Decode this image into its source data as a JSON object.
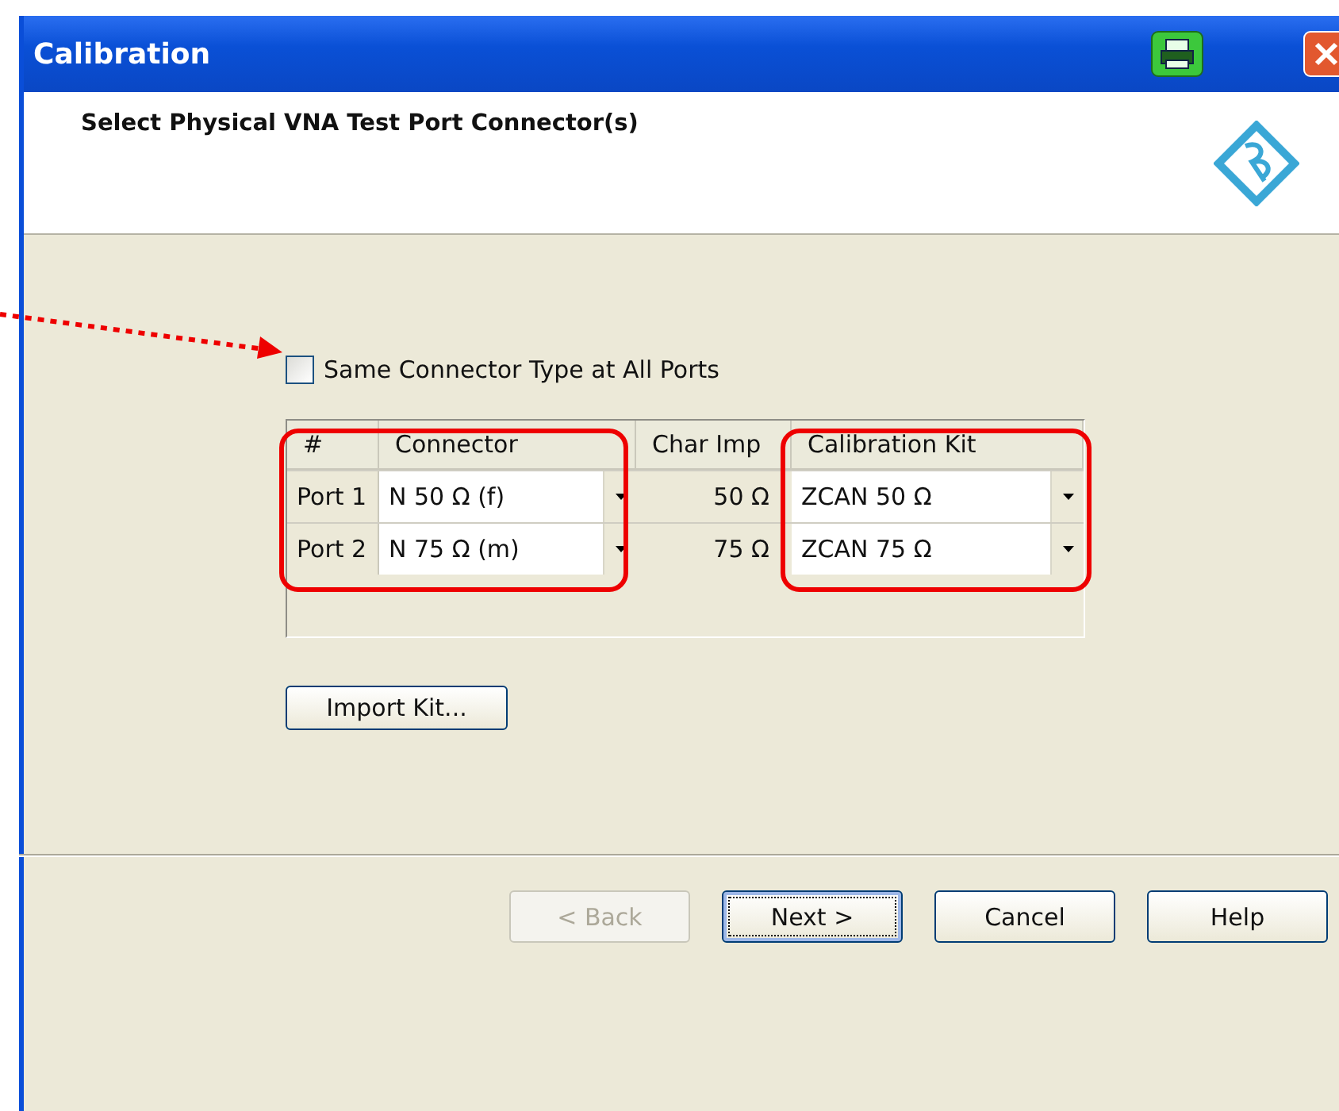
{
  "window": {
    "title": "Calibration"
  },
  "header": {
    "title": "Select Physical VNA Test Port Connector(s)"
  },
  "same_connector": {
    "label": "Same Connector Type at All Ports",
    "checked": false
  },
  "table": {
    "columns": [
      "#",
      "Connector",
      "Char Imp",
      "Calibration Kit"
    ],
    "rows": [
      {
        "port": "Port 1",
        "connector": "N 50 Ω (f)",
        "char_imp": "50 Ω",
        "kit": "ZCAN 50 Ω"
      },
      {
        "port": "Port 2",
        "connector": "N 75 Ω (m)",
        "char_imp": "75 Ω",
        "kit": "ZCAN 75 Ω"
      }
    ]
  },
  "import_button": "Import Kit...",
  "buttons": [
    {
      "label": "< Back",
      "disabled": true,
      "focused": false
    },
    {
      "label": "Next >",
      "disabled": false,
      "focused": true
    },
    {
      "label": "Cancel",
      "disabled": false,
      "focused": false
    },
    {
      "label": "Help",
      "disabled": false,
      "focused": false
    }
  ]
}
